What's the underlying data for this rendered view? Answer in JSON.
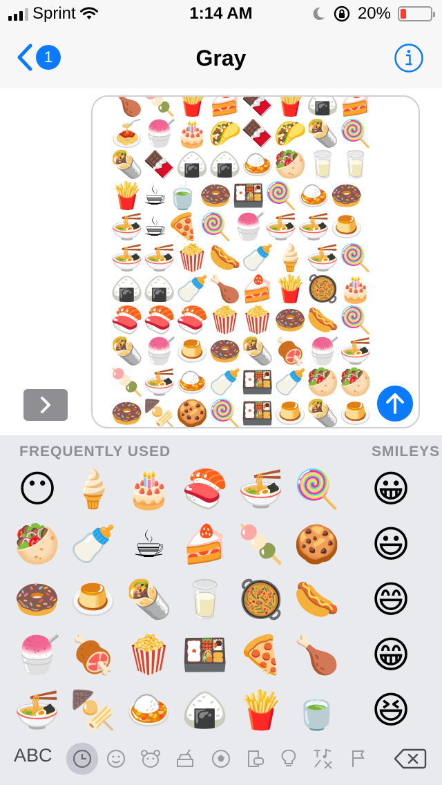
{
  "status_bar": {
    "carrier": "Sprint",
    "time": "1:14 AM",
    "battery_percent": "20%",
    "battery_level": 0.2,
    "battery_color": "#ff3b30"
  },
  "nav": {
    "back_badge": "1",
    "title": "Gray",
    "info_icon": "info-icon",
    "accent": "#0a7aff"
  },
  "draft": {
    "text": "🍗🍡🍟🍰🍫🍟🍙🍰🍝🍧🎂🌮🍫🌮🌯🍭🌯🍫🍙🍙🍛🥙🥛🥛🍟☕🍵🍩🍱🍭🍛🍩🍜☕🍕🍭🍧🍜🍜🍮🍜🍜🍿🌭🍼🍦🍜🍭🍙🍙🍼🍗🍰🍟🥘🎂🍣🍣🍣🍿🍿🍩🌭🍭🌯🍧🍮🍩🌯🍖🍧🍜🍡🍜🍛🍼🍱🍼🥙🥙🍩🍢🍪🍭🍱🍮🌯🍮🌯🍙🍿🥙🍼🍼🍖🍟🍼🍱"
  },
  "keyboard": {
    "section_frequent": "FREQUENTLY USED",
    "section_smileys": "SMILEYS",
    "frequently_used": [
      "😶",
      "🥙",
      "🍩",
      "🍧",
      "🍜",
      "🍦",
      "🍼",
      "🍮",
      "🍖",
      "🍢",
      "🎂",
      "☕",
      "🌯",
      "🍿",
      "🍛",
      "🍣",
      "🍰",
      "🥛",
      "🍱",
      "🍙",
      "🍜",
      "🍡",
      "🥘",
      "🍕",
      "🍟",
      "🍭",
      "🍪",
      "🌭",
      "🍗",
      "🍵"
    ],
    "smileys": [
      "😀",
      "😃",
      "😄",
      "😁",
      "😆"
    ],
    "abc_label": "ABC"
  }
}
